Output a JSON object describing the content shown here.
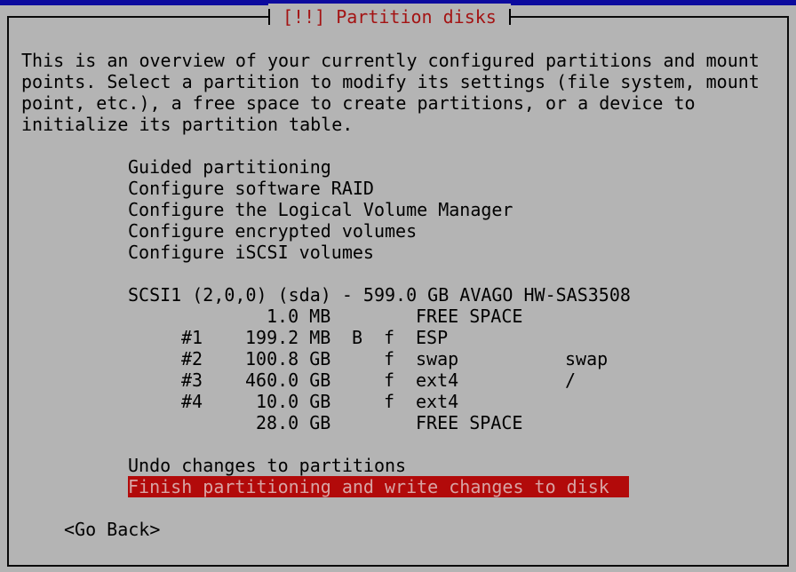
{
  "dialog": {
    "title": "[!!] Partition disks",
    "intro": [
      "This is an overview of your currently configured partitions and mount",
      "points. Select a partition to modify its settings (file system, mount",
      "point, etc.), a free space to create partitions, or a device to",
      "initialize its partition table."
    ]
  },
  "menu": [
    "Guided partitioning",
    "Configure software RAID",
    "Configure the Logical Volume Manager",
    "Configure encrypted volumes",
    "Configure iSCSI volumes"
  ],
  "disk": {
    "header": "SCSI1 (2,0,0) (sda) - 599.0 GB AVAGO HW-SAS3508",
    "rows": [
      {
        "num": "",
        "size": "1.0 MB",
        "boot": "",
        "fmt": "",
        "fs": "FREE SPACE",
        "mount": ""
      },
      {
        "num": "#1",
        "size": "199.2 MB",
        "boot": "B",
        "fmt": "f",
        "fs": "ESP",
        "mount": ""
      },
      {
        "num": "#2",
        "size": "100.8 GB",
        "boot": "",
        "fmt": "f",
        "fs": "swap",
        "mount": "swap"
      },
      {
        "num": "#3",
        "size": "460.0 GB",
        "boot": "",
        "fmt": "f",
        "fs": "ext4",
        "mount": "/"
      },
      {
        "num": "#4",
        "size": "10.0 GB",
        "boot": "",
        "fmt": "f",
        "fs": "ext4",
        "mount": ""
      },
      {
        "num": "",
        "size": "28.0 GB",
        "boot": "",
        "fmt": "",
        "fs": "FREE SPACE",
        "mount": ""
      }
    ]
  },
  "actions": {
    "undo": "Undo changes to partitions",
    "finish": "Finish partitioning and write changes to disk"
  },
  "go_back": "<Go Back>",
  "colors": {
    "background": "#b4b4b4",
    "title": "#a41313",
    "highlight_bg": "#b20a0a",
    "highlight_fg": "#d8a4a4",
    "top_bar": "#0c0a9e"
  }
}
